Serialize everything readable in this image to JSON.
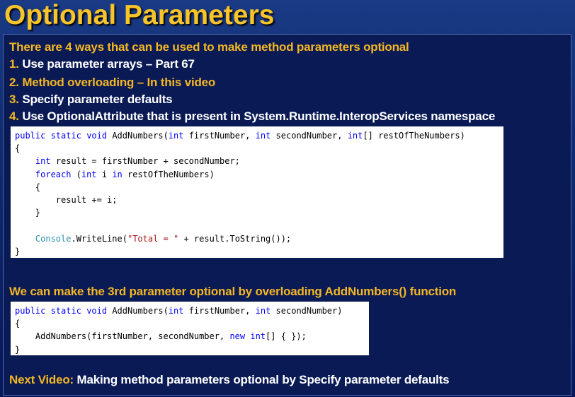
{
  "title": "Optional Parameters",
  "intro": "There are 4 ways that can be used to make method parameters optional",
  "ways": [
    {
      "num": "1.",
      "text": "Use parameter arrays – Part 67",
      "color": "white"
    },
    {
      "num": "2.",
      "text": "Method overloading – In this video",
      "color": "yellow"
    },
    {
      "num": "3.",
      "text": "Specify parameter defaults",
      "color": "white"
    },
    {
      "num": "4.",
      "text": "Use OptionalAttribute that is present in System.Runtime.InteropServices namespace",
      "color": "white"
    }
  ],
  "code1": {
    "lines": [
      [
        [
          "kw",
          "public"
        ],
        [
          "t",
          " "
        ],
        [
          "kw",
          "static"
        ],
        [
          "t",
          " "
        ],
        [
          "kw",
          "void"
        ],
        [
          "t",
          " AddNumbers("
        ],
        [
          "kw",
          "int"
        ],
        [
          "t",
          " firstNumber, "
        ],
        [
          "kw",
          "int"
        ],
        [
          "t",
          " secondNumber, "
        ],
        [
          "kw",
          "int"
        ],
        [
          "t",
          "[] restOfTheNumbers)"
        ]
      ],
      [
        [
          "t",
          "{"
        ]
      ],
      [
        [
          "t",
          "    "
        ],
        [
          "kw",
          "int"
        ],
        [
          "t",
          " result = firstNumber + secondNumber;"
        ]
      ],
      [
        [
          "t",
          "    "
        ],
        [
          "kw",
          "foreach"
        ],
        [
          "t",
          " ("
        ],
        [
          "kw",
          "int"
        ],
        [
          "t",
          " i "
        ],
        [
          "kw",
          "in"
        ],
        [
          "t",
          " restOfTheNumbers)"
        ]
      ],
      [
        [
          "t",
          "    {"
        ]
      ],
      [
        [
          "t",
          "        result += i;"
        ]
      ],
      [
        [
          "t",
          "    }"
        ]
      ],
      [
        [
          "t",
          ""
        ]
      ],
      [
        [
          "t",
          "    "
        ],
        [
          "ty",
          "Console"
        ],
        [
          "t",
          ".WriteLine("
        ],
        [
          "str",
          "\"Total = \""
        ],
        [
          "t",
          " + result.ToString());"
        ]
      ],
      [
        [
          "t",
          "}"
        ]
      ]
    ]
  },
  "overload_note": "We can make the 3rd parameter optional by overloading AddNumbers() function",
  "code2": {
    "lines": [
      [
        [
          "kw",
          "public"
        ],
        [
          "t",
          " "
        ],
        [
          "kw",
          "static"
        ],
        [
          "t",
          " "
        ],
        [
          "kw",
          "void"
        ],
        [
          "t",
          " AddNumbers("
        ],
        [
          "kw",
          "int"
        ],
        [
          "t",
          " firstNumber, "
        ],
        [
          "kw",
          "int"
        ],
        [
          "t",
          " secondNumber)"
        ]
      ],
      [
        [
          "t",
          "{"
        ]
      ],
      [
        [
          "t",
          "    AddNumbers(firstNumber, secondNumber, "
        ],
        [
          "kw",
          "new"
        ],
        [
          "t",
          " "
        ],
        [
          "kw",
          "int"
        ],
        [
          "t",
          "[] { });"
        ]
      ],
      [
        [
          "t",
          "}"
        ]
      ]
    ]
  },
  "next_label": "Next Video:",
  "next_text": " Making method parameters optional by Specify parameter defaults",
  "colors": {
    "accent": "#f4b724",
    "keyword": "#0000ff",
    "type": "#2b91af",
    "string": "#a31515"
  }
}
